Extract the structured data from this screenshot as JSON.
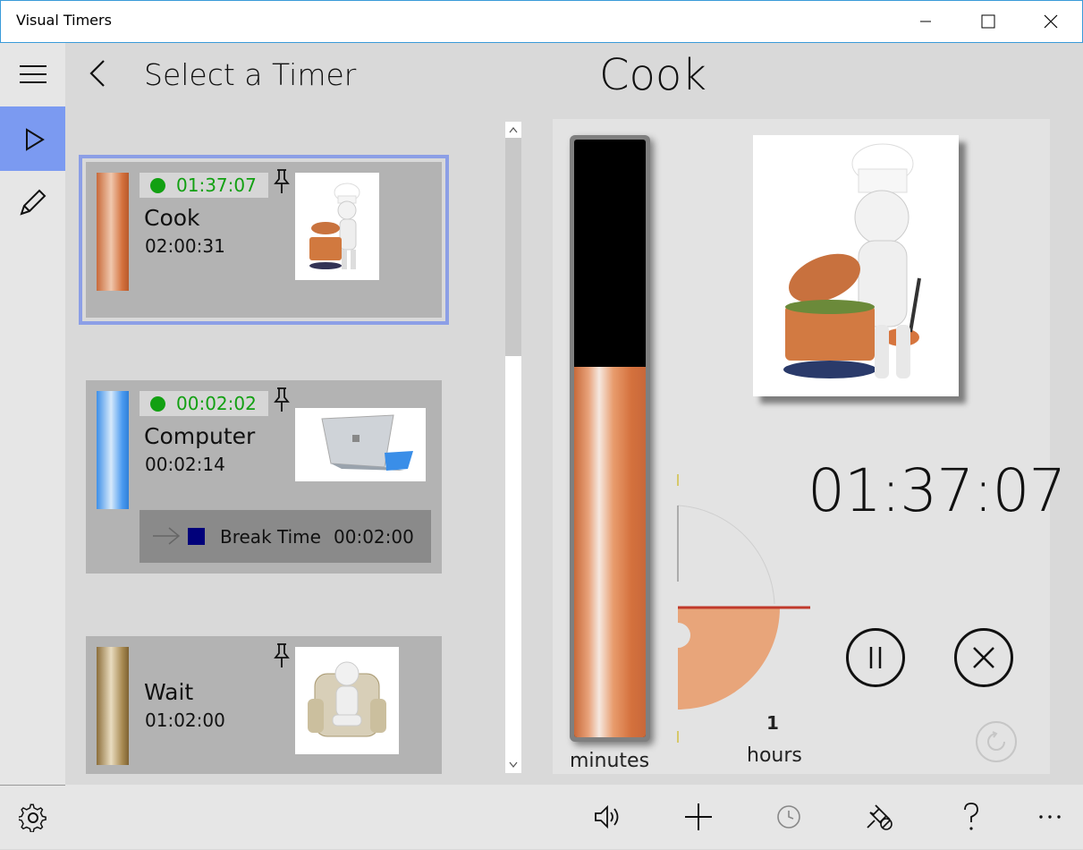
{
  "app": {
    "title": "Visual Timers"
  },
  "header": {
    "list_title": "Select a Timer",
    "selected_timer_title": "Cook"
  },
  "timers": [
    {
      "name": "Cook",
      "remaining": "01:37:07",
      "duration": "02:00:31",
      "running": true,
      "selected": true,
      "pinned_icon": "pin-icon",
      "image": "chef-cooking-pot",
      "color": "#d4713d"
    },
    {
      "name": "Computer",
      "remaining": "00:02:02",
      "duration": "00:02:14",
      "running": true,
      "selected": false,
      "pinned_icon": "pin-icon",
      "image": "surface-tablet",
      "chained": {
        "name": "Break Time",
        "duration": "00:02:00",
        "color": "#00007a"
      }
    },
    {
      "name": "Wait",
      "remaining": "",
      "duration": "01:02:00",
      "running": false,
      "selected": false,
      "pinned_icon": "pin-icon",
      "image": "figure-in-armchair"
    }
  ],
  "detail": {
    "countdown": "01:37:07",
    "minutes_label": "minutes",
    "hours_value": "1",
    "hours_label": "hours",
    "minutes_fill_fraction": 0.62,
    "hours_pie_fraction": 0.25,
    "accent_color": "#e8a57a",
    "marker_color": "#c0392b"
  },
  "commands": [
    "sound-icon",
    "add-icon",
    "clock-icon",
    "unpin-icon",
    "help-icon",
    "more-icon"
  ]
}
